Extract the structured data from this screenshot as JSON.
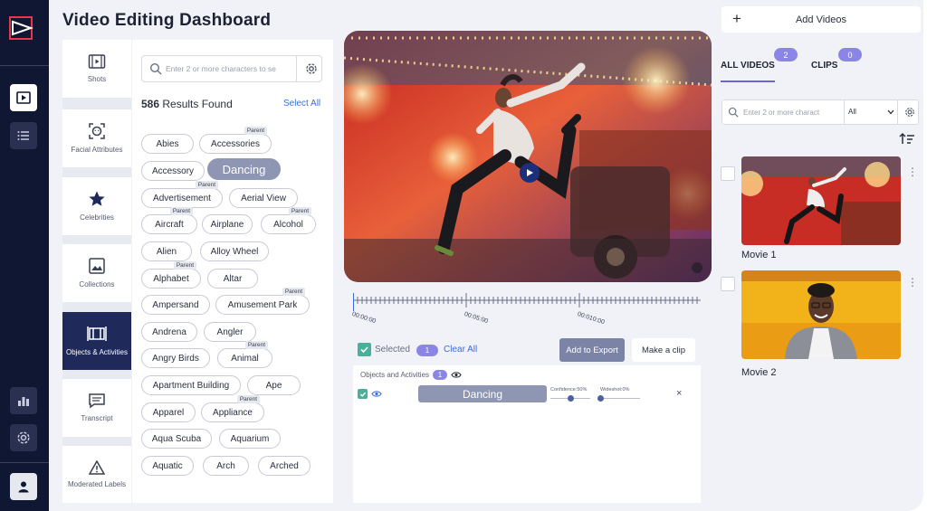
{
  "app": {
    "title": "Video Editing Dashboard"
  },
  "rail": {
    "icons": [
      "logo-icon",
      "video-library-icon",
      "list-icon",
      "bar-chart-icon",
      "settings-icon",
      "user-icon"
    ]
  },
  "categories": [
    {
      "label": "Shots",
      "icon": "film-icon"
    },
    {
      "label": "Facial Attributes",
      "icon": "face-scan-icon"
    },
    {
      "label": "Celebrities",
      "icon": "star-icon"
    },
    {
      "label": "Collections",
      "icon": "image-icon"
    },
    {
      "label": "Objects & Activities",
      "icon": "objects-icon",
      "active": true
    },
    {
      "label": "Transcript",
      "icon": "chat-icon"
    },
    {
      "label": "Moderated Labels",
      "icon": "warning-icon"
    }
  ],
  "tags_panel": {
    "search_placeholder": "Enter 2 or more characters to se",
    "results_count": "586",
    "results_suffix": " Results Found",
    "select_all": "Select All",
    "parent_label": "Parent",
    "tags": [
      {
        "label": "Abies"
      },
      {
        "label": "Accessories",
        "parent": true
      },
      {
        "label": "Accessory"
      },
      {
        "label": "Dancing",
        "selected": true
      },
      {
        "label": "Advertisement",
        "parent": true
      },
      {
        "label": "Aerial View"
      },
      {
        "label": "Aircraft",
        "parent": true
      },
      {
        "label": "Airplane"
      },
      {
        "label": "Alcohol",
        "parent": true
      },
      {
        "label": "Alien"
      },
      {
        "label": "Alloy Wheel"
      },
      {
        "label": "Alphabet",
        "parent": true
      },
      {
        "label": "Altar"
      },
      {
        "label": "Ampersand"
      },
      {
        "label": "Amusement Park",
        "parent": true
      },
      {
        "label": "Andrena"
      },
      {
        "label": "Angler"
      },
      {
        "label": "Angry Birds"
      },
      {
        "label": "Animal",
        "parent": true
      },
      {
        "label": "Apartment Building"
      },
      {
        "label": "Ape"
      },
      {
        "label": "Apparel"
      },
      {
        "label": "Appliance",
        "parent": true
      },
      {
        "label": "Aqua Scuba"
      },
      {
        "label": "Aquarium"
      },
      {
        "label": "Aquatic"
      },
      {
        "label": "Arch"
      },
      {
        "label": "Arched"
      }
    ]
  },
  "timeline": {
    "labels": [
      "00:00:00",
      "00:05:00",
      "00:010:00"
    ]
  },
  "selection": {
    "selected_label": "Selected",
    "selected_count": "1",
    "clear_all": "Clear All",
    "add_to_export": "Add to Export",
    "make_clip": "Make a clip",
    "group_label": "Objects and Activities",
    "group_count": "1",
    "item_label": "Dancing",
    "confidence_label": "Confidence:50%",
    "confidence_value": 0.5,
    "wideshot_label": "Wideshot:0%",
    "wideshot_value": 0.0,
    "close_symbol": "×"
  },
  "right_panel": {
    "add_videos": "Add Videos",
    "tabs": [
      {
        "label": "ALL VIDEOS",
        "count": "2",
        "active": true
      },
      {
        "label": "CLIPS",
        "count": "0"
      }
    ],
    "search_placeholder": "Enter 2 or more charact",
    "filter_value": "All",
    "videos": [
      {
        "title": "Movie 1"
      },
      {
        "title": "Movie 2"
      }
    ]
  },
  "colors": {
    "accent": "#8b86e6",
    "rail": "#0f1733",
    "active_category": "#1f2a5a",
    "selected_tag": "#8e96b3",
    "link": "#3a6ed8",
    "check": "#49b09a"
  }
}
